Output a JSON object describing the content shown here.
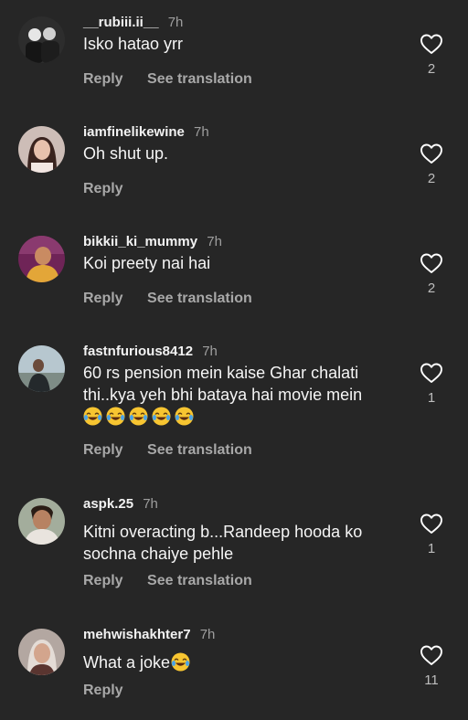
{
  "comments": [
    {
      "username": "__rubiii.ii__",
      "time": "7h",
      "text": "Isko hatao yrr",
      "reply": "Reply",
      "see_translation": "See translation",
      "likes": "2",
      "avatar_colors": [
        "#3a3a3a",
        "#d9d9d9"
      ]
    },
    {
      "username": "iamfinelikewine",
      "time": "7h",
      "text": "Oh shut up.",
      "reply": "Reply",
      "likes": "2",
      "avatar_colors": [
        "#d8c7c0",
        "#3b2520"
      ]
    },
    {
      "username": "bikkii_ki_mummy",
      "time": "7h",
      "text": "Koi preety nai hai",
      "reply": "Reply",
      "see_translation": "See translation",
      "likes": "2",
      "avatar_colors": [
        "#7d2a63",
        "#e0a23a"
      ]
    },
    {
      "username": "fastnfurious8412",
      "time": "7h",
      "text_line1": "60 rs pension mein kaise Ghar chalati",
      "text_line2": "thi..kya yeh bhi bataya hai movie mein",
      "reply": "Reply",
      "see_translation": "See translation",
      "likes": "1",
      "avatar_colors": [
        "#a7b7bf",
        "#2f3437"
      ]
    },
    {
      "username": "aspk.25",
      "time": "7h",
      "text_line1": "Kitni overacting b...Randeep hooda ko",
      "text_line2": "sochna chaiye pehle",
      "reply": "Reply",
      "see_translation": "See translation",
      "likes": "1",
      "avatar_colors": [
        "#9fa79a",
        "#6b4a34"
      ]
    },
    {
      "username": "mehwishakhter7",
      "time": "7h",
      "text": "What a joke",
      "reply": "Reply",
      "likes": "11",
      "avatar_colors": [
        "#b8aca6",
        "#5a3d36"
      ]
    }
  ],
  "icons": {
    "like": "heart-outline-icon",
    "emoji": "face-with-tears-of-joy"
  },
  "theme": {
    "background": "#262626",
    "primary_text": "#f5f5f5",
    "secondary_text": "#a8a8a8"
  }
}
